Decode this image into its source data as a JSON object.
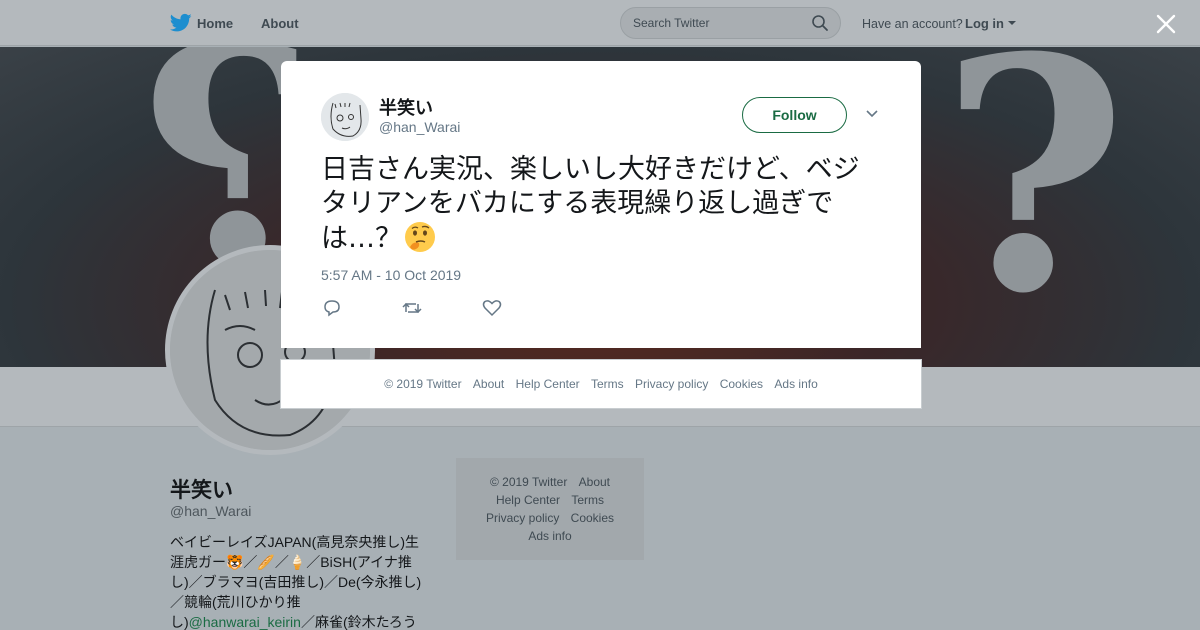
{
  "nav": {
    "home": "Home",
    "about": "About",
    "search_placeholder": "Search Twitter",
    "have_account": "Have an account?",
    "login": "Log in"
  },
  "profile": {
    "name": "半笑い",
    "handle": "@han_Warai",
    "bio_text": "ベイビーレイズJAPAN(高見奈央推し)生涯虎ガー🐯／🥖／🍦／BiSH(アイナ推し)／ブラマヨ(吉田推し)／De(今永推し)／競輪(荒川ひかり推し)",
    "bio_link": "@hanwarai_keirin",
    "bio_tail": "／麻雀(鈴木たろう"
  },
  "side_footer": {
    "items": [
      "© 2019 Twitter",
      "About",
      "Help Center",
      "Terms",
      "Privacy policy",
      "Cookies",
      "Ads info"
    ]
  },
  "tweet": {
    "name": "半笑い",
    "handle": "@han_Warai",
    "follow": "Follow",
    "text": "日吉さん実況、楽しいし大好きだけど、ベジタリアンをバカにする表現繰り返し過ぎでは…？",
    "timestamp": "5:57 AM - 10 Oct 2019"
  },
  "card_footer": {
    "items": [
      "© 2019 Twitter",
      "About",
      "Help Center",
      "Terms",
      "Privacy policy",
      "Cookies",
      "Ads info"
    ]
  },
  "colors": {
    "twitter_blue": "#1da1f2",
    "follow_green": "#1a6b43",
    "muted_text": "#657786"
  }
}
